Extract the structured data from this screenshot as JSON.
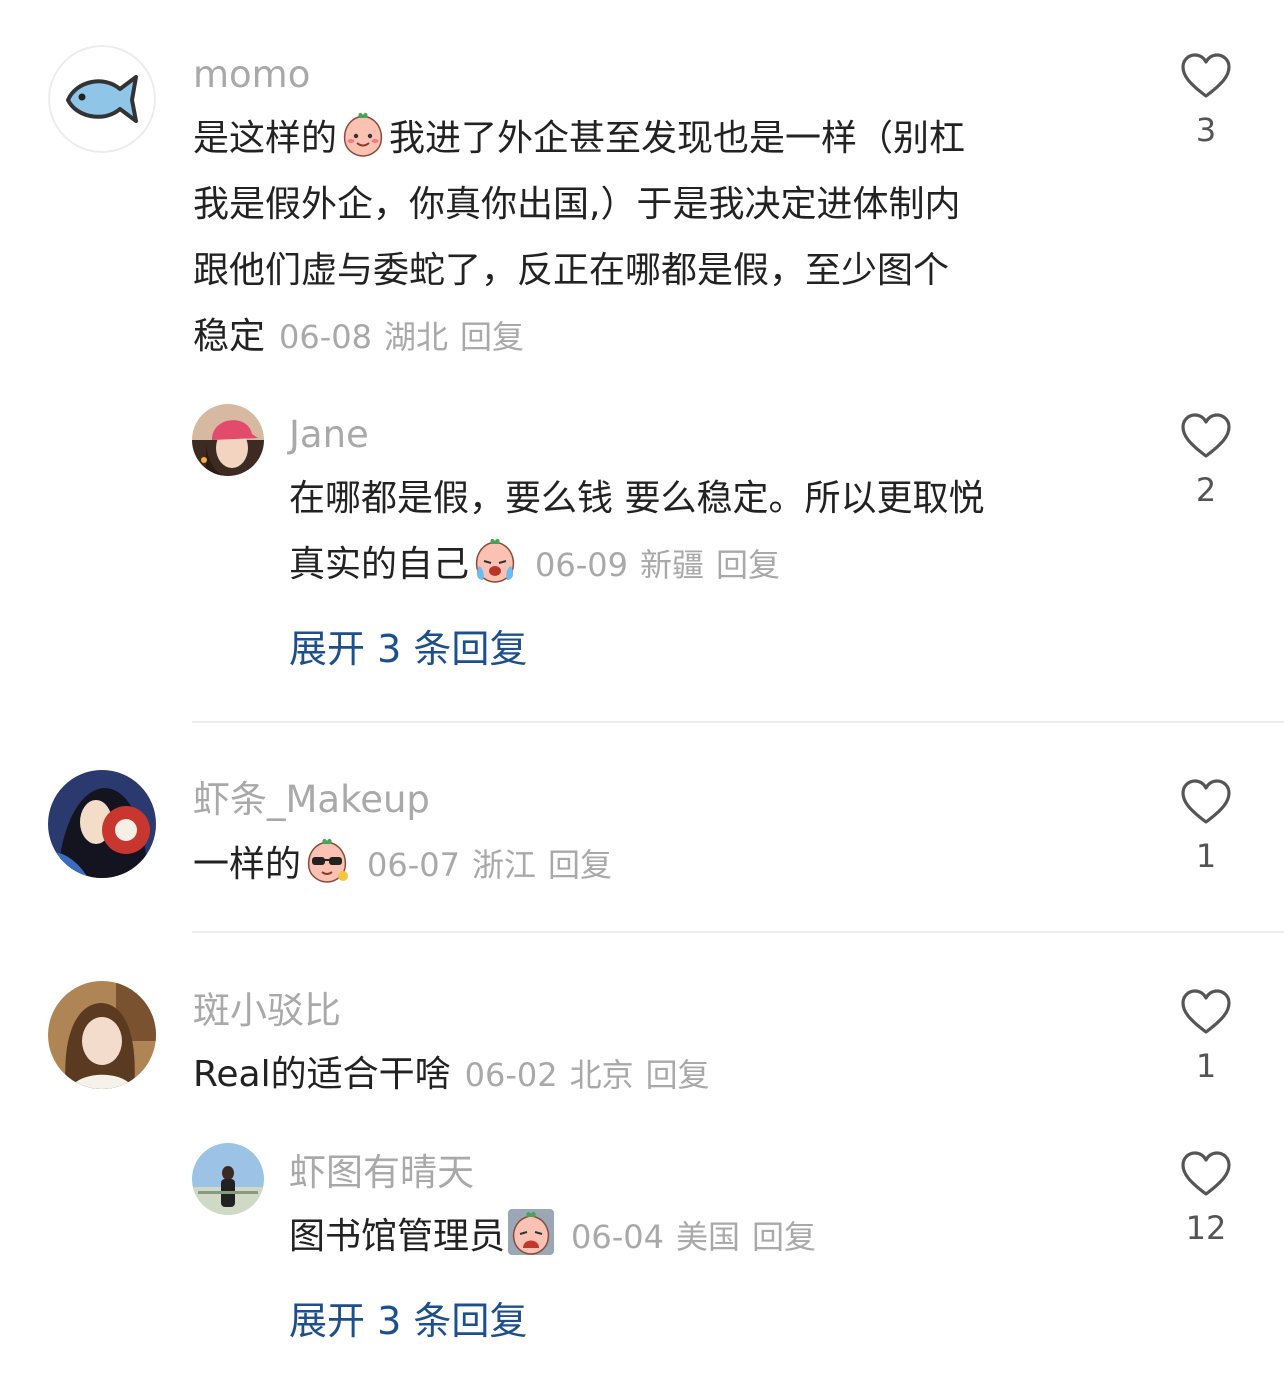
{
  "comments": [
    {
      "username": "momo",
      "lines": [
        [
          "是这样的",
          "emoji",
          "我进了外企甚至发现也是一样（别杠"
        ],
        [
          "我是假外企，你真你出国,）于是我决定进体制内"
        ],
        [
          "跟他们虚与委蛇了，反正在哪都是假，至少图个"
        ],
        [
          "稳定"
        ]
      ],
      "date": "06-08",
      "location": "湖北",
      "reply": "回复",
      "likes": "3",
      "avatar_icon": "fish-icon"
    },
    {
      "username": "Jane",
      "lines": [
        [
          "在哪都是假，要么钱 要么稳定。所以更取悦"
        ],
        [
          "真实的自己",
          "emoji"
        ]
      ],
      "date": "06-09",
      "location": "新疆",
      "reply": "回复",
      "likes": "2",
      "expand": "展开 3 条回复"
    },
    {
      "username": "虾条_Makeup",
      "lines": [
        [
          "一样的",
          "emoji"
        ]
      ],
      "date": "06-07",
      "location": "浙江",
      "reply": "回复",
      "likes": "1"
    },
    {
      "username": "斑小驳比",
      "lines": [
        [
          "Real的适合干啥"
        ]
      ],
      "date": "06-02",
      "location": "北京",
      "reply": "回复",
      "likes": "1"
    },
    {
      "username": "虾图有晴天",
      "lines": [
        [
          "图书馆管理员",
          "emoji"
        ]
      ],
      "date": "06-04",
      "location": "美国",
      "reply": "回复",
      "likes": "12",
      "expand": "展开 3 条回复"
    }
  ],
  "colors": {
    "username": "#a9a9a9",
    "text": "#222222",
    "meta": "#a9a9a9",
    "link": "#1d4f8c",
    "divider": "#ececec"
  }
}
